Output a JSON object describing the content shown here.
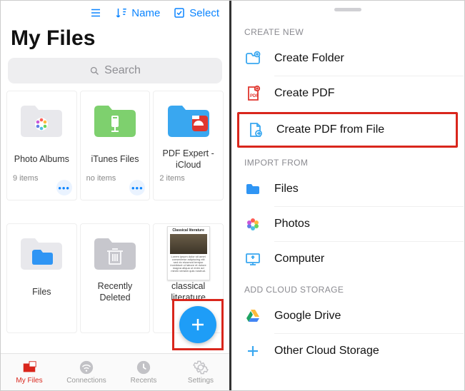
{
  "topbar": {
    "sort_label": "Name",
    "select_label": "Select"
  },
  "title": "My Files",
  "search": {
    "placeholder": "Search"
  },
  "grid": {
    "items": [
      {
        "label": "Photo Albums",
        "sub": "9 items"
      },
      {
        "label": "iTunes Files",
        "sub": "no items"
      },
      {
        "label": "PDF Expert - iCloud",
        "sub": "2 items"
      },
      {
        "label": "Files",
        "sub": ""
      },
      {
        "label": "Recently Deleted",
        "sub": ""
      },
      {
        "label": "classical literature",
        "sub": "",
        "thumb_title": "Classical literature"
      }
    ]
  },
  "tabs": {
    "my_files": "My Files",
    "connections": "Connections",
    "recents": "Recents",
    "settings": "Settings"
  },
  "right": {
    "create_header": "CREATE NEW",
    "create": {
      "folder": "Create Folder",
      "pdf": "Create PDF",
      "pdf_from_file": "Create PDF from File"
    },
    "import_header": "IMPORT FROM",
    "import": {
      "files": "Files",
      "photos": "Photos",
      "computer": "Computer"
    },
    "cloud_header": "ADD CLOUD STORAGE",
    "cloud": {
      "gdrive": "Google Drive",
      "other": "Other Cloud Storage"
    }
  }
}
